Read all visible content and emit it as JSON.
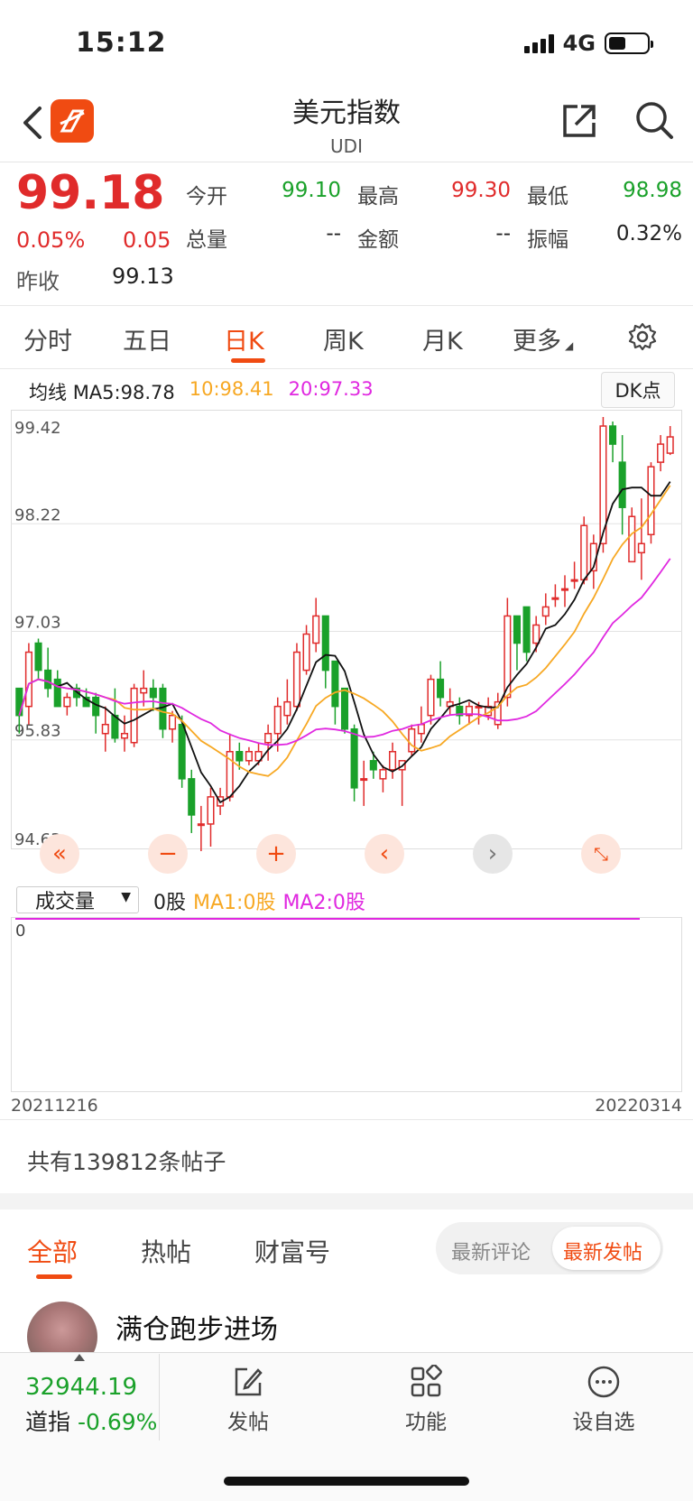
{
  "status": {
    "time": "15:12",
    "network": "4G"
  },
  "header": {
    "title": "美元指数",
    "subtitle": "UDI"
  },
  "quote": {
    "price": "99.18",
    "change_pct": "0.05%",
    "change": "0.05",
    "prev_close_label": "昨收",
    "prev_close": "99.13",
    "open_label": "今开",
    "open": "99.10",
    "high_label": "最高",
    "high": "99.30",
    "low_label": "最低",
    "low": "98.98",
    "volume_label": "总量",
    "volume": "--",
    "amount_label": "金额",
    "amount": "--",
    "amplitude_label": "振幅",
    "amplitude": "0.32%"
  },
  "ktabs": [
    "分时",
    "五日",
    "日K",
    "周K",
    "月K",
    "更多"
  ],
  "ma": {
    "label": "均线",
    "ma5": "MA5:98.78",
    "ma10": "10:98.41",
    "ma20": "20:97.33"
  },
  "dk_button": "DK点",
  "colors": {
    "up": "#e02b2b",
    "down": "#1aa12a",
    "ma5": "#111111",
    "ma10": "#f7a823",
    "ma20": "#e028e0",
    "accent": "#f04b12"
  },
  "chart_data": {
    "type": "candlestick",
    "y_ticks": [
      "99.42",
      "98.22",
      "97.03",
      "95.83",
      "94.63"
    ],
    "ylim": [
      94.63,
      99.42
    ],
    "ohlc": [
      [
        96.4,
        96.4,
        95.9,
        96.1
      ],
      [
        96.2,
        96.9,
        96.0,
        96.8
      ],
      [
        96.9,
        96.95,
        96.5,
        96.6
      ],
      [
        96.6,
        96.85,
        96.3,
        96.4
      ],
      [
        96.5,
        96.6,
        96.2,
        96.2
      ],
      [
        96.2,
        96.35,
        96.1,
        96.3
      ],
      [
        96.4,
        96.45,
        96.2,
        96.3
      ],
      [
        96.3,
        96.4,
        96.2,
        96.2
      ],
      [
        96.3,
        96.35,
        95.9,
        96.1
      ],
      [
        95.9,
        96.2,
        95.7,
        96.0
      ],
      [
        96.1,
        96.4,
        95.8,
        95.85
      ],
      [
        95.85,
        96.1,
        95.7,
        95.9
      ],
      [
        95.8,
        96.45,
        95.75,
        96.4
      ],
      [
        96.35,
        96.6,
        96.2,
        96.4
      ],
      [
        96.4,
        96.5,
        96.15,
        96.3
      ],
      [
        96.4,
        96.45,
        95.85,
        95.95
      ],
      [
        95.95,
        96.15,
        95.8,
        96.1
      ],
      [
        96.0,
        96.1,
        95.3,
        95.4
      ],
      [
        95.4,
        95.5,
        94.8,
        95.0
      ],
      [
        94.9,
        95.1,
        94.6,
        94.9
      ],
      [
        94.9,
        95.3,
        94.65,
        95.2
      ],
      [
        95.1,
        95.3,
        95.0,
        95.2
      ],
      [
        95.2,
        95.9,
        95.15,
        95.7
      ],
      [
        95.7,
        95.8,
        95.5,
        95.6
      ],
      [
        95.6,
        95.75,
        95.55,
        95.7
      ],
      [
        95.6,
        95.8,
        95.55,
        95.7
      ],
      [
        95.8,
        96.0,
        95.6,
        95.9
      ],
      [
        95.9,
        96.3,
        95.7,
        96.2
      ],
      [
        96.1,
        96.5,
        96.0,
        96.25
      ],
      [
        96.2,
        96.9,
        96.15,
        96.8
      ],
      [
        96.6,
        97.1,
        96.55,
        97.0
      ],
      [
        96.9,
        97.4,
        96.8,
        97.2
      ],
      [
        97.2,
        97.1,
        96.4,
        96.6
      ],
      [
        96.7,
        96.6,
        96.0,
        96.2
      ],
      [
        96.4,
        96.4,
        95.9,
        95.95
      ],
      [
        95.95,
        96.0,
        95.15,
        95.3
      ],
      [
        95.4,
        95.6,
        95.1,
        95.4
      ],
      [
        95.6,
        95.7,
        95.4,
        95.5
      ],
      [
        95.4,
        95.55,
        95.25,
        95.5
      ],
      [
        95.5,
        95.8,
        95.4,
        95.7
      ],
      [
        95.5,
        95.6,
        95.1,
        95.6
      ],
      [
        95.7,
        96.0,
        95.65,
        95.95
      ],
      [
        95.9,
        96.2,
        95.8,
        96.0
      ],
      [
        96.1,
        96.55,
        96.0,
        96.5
      ],
      [
        96.5,
        96.7,
        96.2,
        96.3
      ],
      [
        96.2,
        96.4,
        96.1,
        96.25
      ],
      [
        96.2,
        96.3,
        96.0,
        96.1
      ],
      [
        96.1,
        96.25,
        96.0,
        96.2
      ],
      [
        96.2,
        96.25,
        96.0,
        96.2
      ],
      [
        96.1,
        96.3,
        96.05,
        96.2
      ],
      [
        96.0,
        96.35,
        95.95,
        96.25
      ],
      [
        96.3,
        97.4,
        96.2,
        97.2
      ],
      [
        97.2,
        97.2,
        96.6,
        96.9
      ],
      [
        97.3,
        97.2,
        96.7,
        96.8
      ],
      [
        96.9,
        97.2,
        96.8,
        97.1
      ],
      [
        97.2,
        97.45,
        97.1,
        97.3
      ],
      [
        97.4,
        97.55,
        97.3,
        97.4
      ],
      [
        97.5,
        97.65,
        97.3,
        97.5
      ],
      [
        97.6,
        97.8,
        97.5,
        97.6
      ],
      [
        97.6,
        98.3,
        97.55,
        98.2
      ],
      [
        97.7,
        98.1,
        97.5,
        98.0
      ],
      [
        98.0,
        99.4,
        97.9,
        99.3
      ],
      [
        99.3,
        99.35,
        98.9,
        99.1
      ],
      [
        98.9,
        99.2,
        98.1,
        98.4
      ],
      [
        97.8,
        98.4,
        97.8,
        98.3
      ],
      [
        97.9,
        98.5,
        97.6,
        98.0
      ],
      [
        98.1,
        98.9,
        98.0,
        98.85
      ],
      [
        98.9,
        99.2,
        98.8,
        99.1
      ],
      [
        99.0,
        99.3,
        98.98,
        99.18
      ]
    ],
    "ma_series": [
      "MA5",
      "MA10",
      "MA20"
    ]
  },
  "volume": {
    "selector": "成交量",
    "value": "0股",
    "ma1": "MA1:0股",
    "ma2": "MA2:0股",
    "axis_zero": "0",
    "date_start": "20211216",
    "date_end": "20220314"
  },
  "posts": {
    "count_text": "共有139812条帖子",
    "tabs": [
      "全部",
      "热帖",
      "财富号"
    ],
    "sort_a": "最新评论",
    "sort_b": "最新发帖",
    "first_user": "满仓跑步进场"
  },
  "bottom": {
    "index_value": "32944.19",
    "index_name": "道指",
    "index_change": "-0.69%",
    "nav": [
      "发帖",
      "功能",
      "设自选"
    ]
  }
}
